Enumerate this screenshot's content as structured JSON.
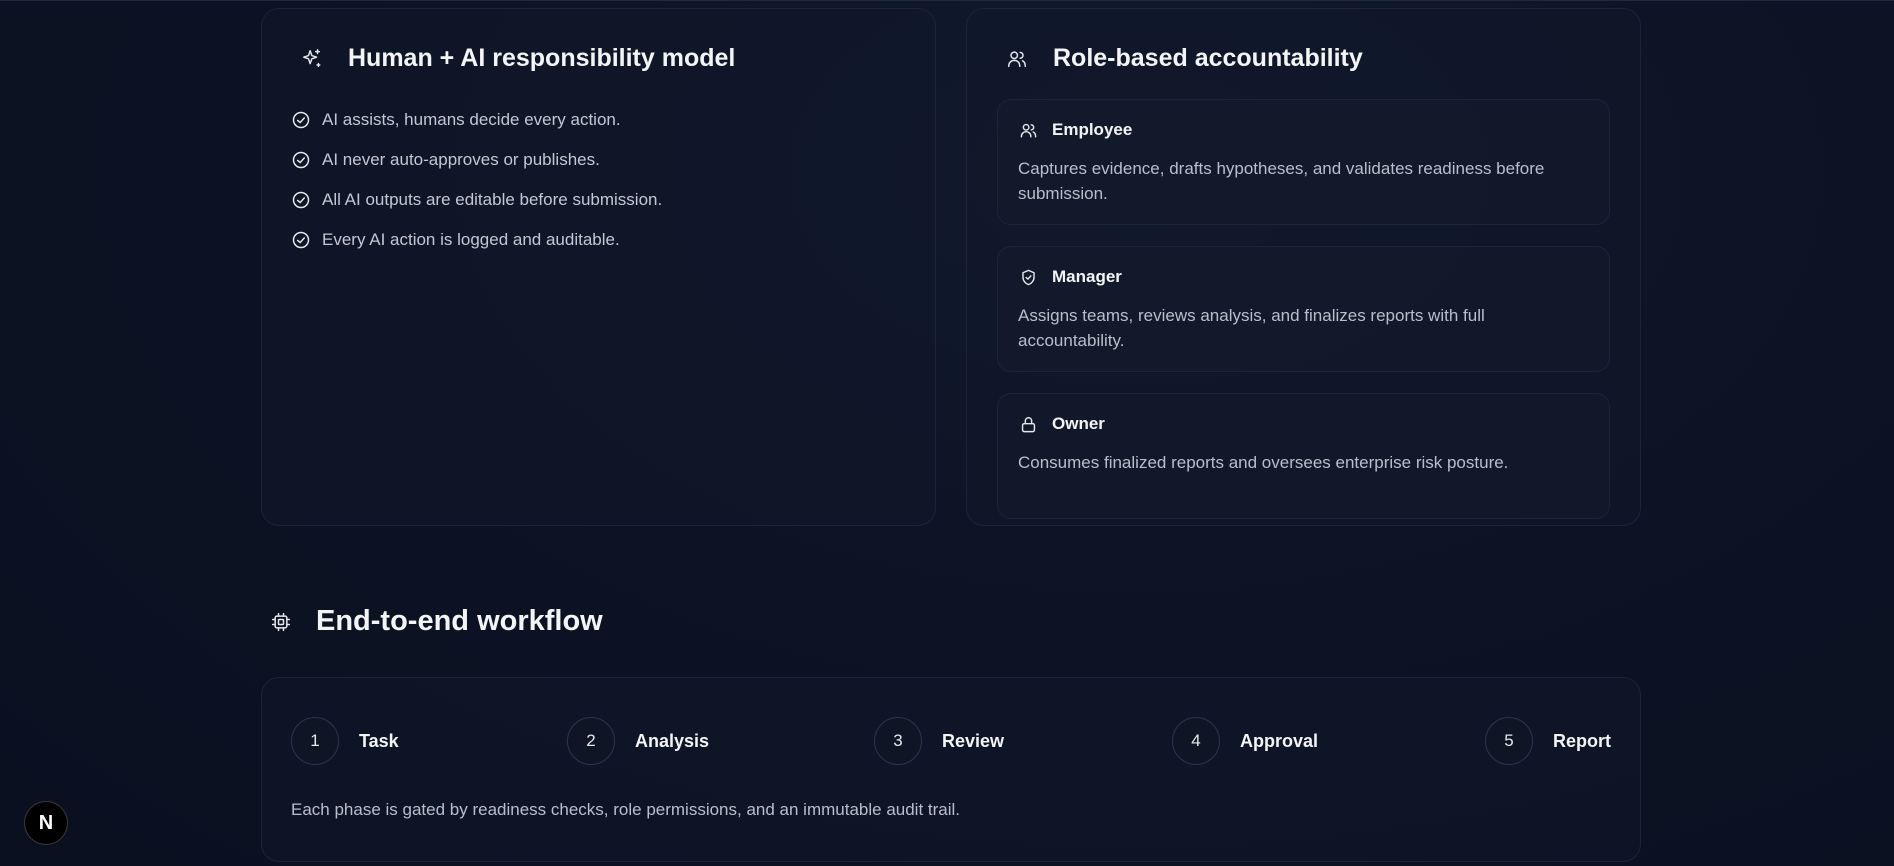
{
  "responsibility": {
    "title": "Human + AI responsibility model",
    "title_icon": "sparkles-icon",
    "items": [
      {
        "text": "AI assists, humans decide every action.",
        "icon": "check-circle-icon"
      },
      {
        "text": "AI never auto-approves or publishes.",
        "icon": "check-circle-icon"
      },
      {
        "text": "All AI outputs are editable before submission.",
        "icon": "check-circle-icon"
      },
      {
        "text": "Every AI action is logged and auditable.",
        "icon": "check-circle-icon"
      }
    ]
  },
  "roles": {
    "title": "Role-based accountability",
    "title_icon": "users-icon",
    "items": [
      {
        "name": "Employee",
        "icon": "users-icon",
        "description": "Captures evidence, drafts hypotheses, and validates readiness before submission."
      },
      {
        "name": "Manager",
        "icon": "shield-check-icon",
        "description": "Assigns teams, reviews analysis, and finalizes reports with full accountability."
      },
      {
        "name": "Owner",
        "icon": "lock-icon",
        "description": "Consumes finalized reports and oversees enterprise risk posture."
      }
    ]
  },
  "workflow": {
    "title": "End-to-end workflow",
    "title_icon": "cpu-icon",
    "steps": [
      {
        "number": "1",
        "label": "Task"
      },
      {
        "number": "2",
        "label": "Analysis"
      },
      {
        "number": "3",
        "label": "Review"
      },
      {
        "number": "4",
        "label": "Approval"
      },
      {
        "number": "5",
        "label": "Report"
      }
    ],
    "footnote": "Each phase is gated by readiness checks, role permissions, and an immutable audit trail."
  },
  "dev_badge": {
    "label": "N",
    "icon": "nextjs-logo-icon"
  },
  "colors": {
    "background": "#0c1324",
    "card_border": "#1b2538",
    "text_primary": "#f3f4f6",
    "text_secondary": "#b9bfca"
  }
}
